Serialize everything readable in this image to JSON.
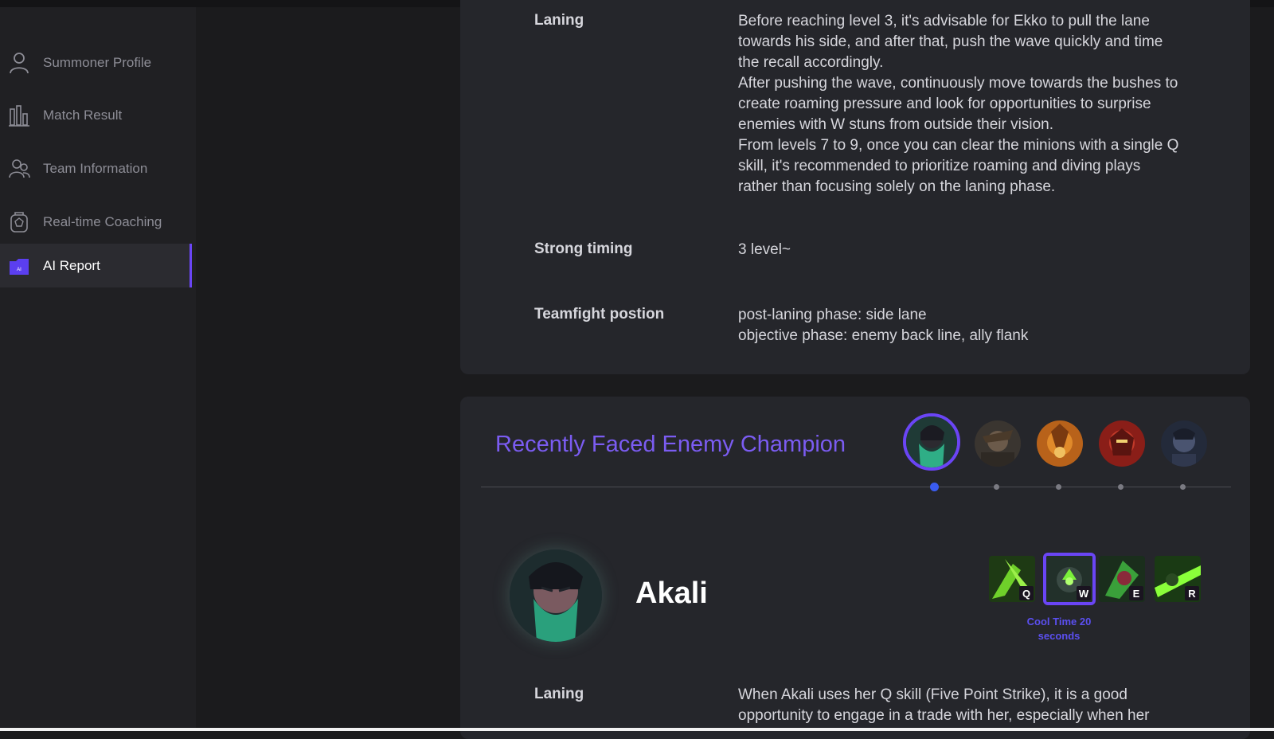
{
  "sidebar": {
    "items": [
      {
        "label": "Summoner Profile",
        "icon": "user-icon"
      },
      {
        "label": "Match Result",
        "icon": "bar-chart-icon"
      },
      {
        "label": "Team Information",
        "icon": "team-icon"
      },
      {
        "label": "Real-time Coaching",
        "icon": "coaching-icon"
      },
      {
        "label": "AI Report",
        "icon": "ai-report-icon",
        "active": true
      }
    ]
  },
  "ekko_guide": {
    "laning_label": "Laning",
    "laning_paragraphs": [
      "Before reaching level 3, it's advisable for Ekko to pull the lane towards his side, and after that, push the wave quickly and time the recall accordingly.",
      "After pushing the wave, continuously move towards the bushes to create roaming pressure and look for opportunities to surprise enemies with W stuns from outside their vision.",
      "From levels 7 to 9, once you can clear the minions with a single Q skill, it's recommended to prioritize roaming and diving plays rather than focusing solely on the laning phase."
    ],
    "strong_timing_label": "Strong timing",
    "strong_timing_value": "3 level~",
    "teamfight_label": "Teamfight postion",
    "teamfight_lines": [
      "post-laning phase: side lane",
      "objective phase: enemy back line, ally flank"
    ]
  },
  "enemy_section": {
    "title": "Recently Faced Enemy Champion",
    "selected_index": 0,
    "champion_name": "Akali",
    "skills": [
      {
        "key": "Q"
      },
      {
        "key": "W",
        "active": true
      },
      {
        "key": "E"
      },
      {
        "key": "R"
      }
    ],
    "cooltime_text": "Cool Time 20 seconds",
    "laning_label": "Laning",
    "laning_text": "When Akali uses her Q skill (Five Point Strike), it is a good opportunity to engage in a trade with her, especially when her"
  },
  "colors": {
    "accent": "#6a45f5",
    "title_purple": "#7b5cf2",
    "timeline_dot_active": "#3a5cf0"
  }
}
